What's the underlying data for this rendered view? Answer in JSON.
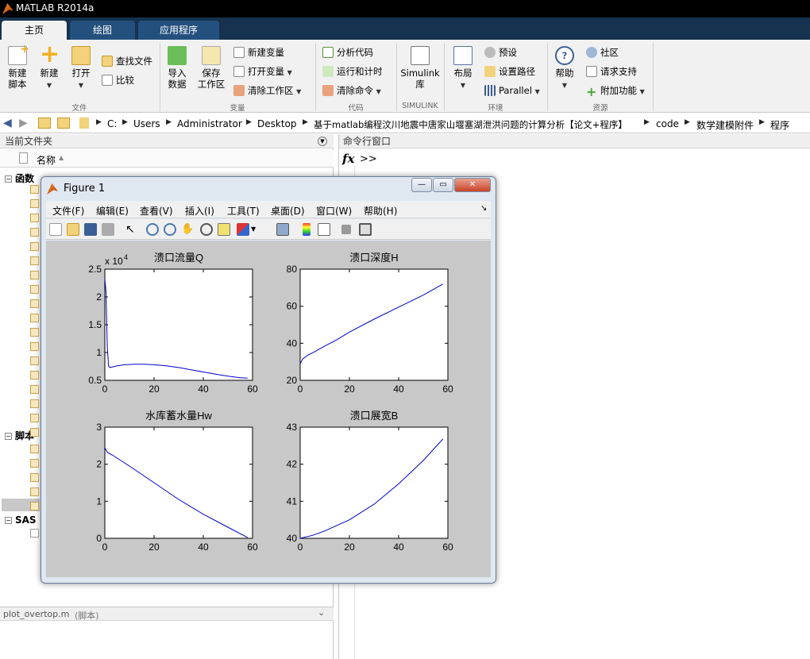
{
  "app": {
    "title": "MATLAB R2014a"
  },
  "tabs": [
    {
      "label": "主页"
    },
    {
      "label": "绘图"
    },
    {
      "label": "应用程序"
    }
  ],
  "ribbon": {
    "file": {
      "new_script": [
        "新建",
        "脚本"
      ],
      "new": "新建",
      "open": "打开",
      "find_files": "查找文件",
      "compare": "比较",
      "group": "文件"
    },
    "variable": {
      "import": [
        "导入",
        "数据"
      ],
      "save_ws": [
        "保存",
        "工作区"
      ],
      "new_var": "新建变量",
      "open_var": "打开变量",
      "clear_ws": "清除工作区",
      "group": "变量"
    },
    "code": {
      "analyze": "分析代码",
      "run_time": "运行和计时",
      "clear_cmd": "清除命令",
      "group": "代码"
    },
    "simulink": {
      "lib": [
        "Simulink",
        "库"
      ],
      "group": "SIMULINK"
    },
    "env": {
      "layout": "布局",
      "prefs": "预设",
      "set_path": "设置路径",
      "parallel": "Parallel",
      "group": "环境"
    },
    "res": {
      "help": "帮助",
      "community": "社区",
      "support": "请求支持",
      "addons": "附加功能",
      "group": "资源"
    }
  },
  "address": [
    "C:",
    "Users",
    "Administrator",
    "Desktop",
    "基于matlab编程汶川地震中唐家山堰塞湖泄洪问题的计算分析【论文+程序】",
    "code",
    "数学建模附件",
    "程序"
  ],
  "current_folder": {
    "title": "当前文件夹",
    "col_name": "名称",
    "group_functions": "函数",
    "group_scripts": "脚本",
    "group_sas": "SAS",
    "details_file": "plot_overtop.m",
    "details_type": "(脚本)"
  },
  "command": {
    "title": "命令行窗口",
    "fx": "fx",
    "prompt": ">>"
  },
  "figure": {
    "title": "Figure 1",
    "menu": [
      "文件(F)",
      "编辑(E)",
      "查看(V)",
      "插入(I)",
      "工具(T)",
      "桌面(D)",
      "窗口(W)",
      "帮助(H)"
    ]
  },
  "colors": {
    "line": "#0000cc",
    "plot_bg": "#c8c8c8",
    "tab_bg": "#16324f"
  },
  "chart_data": [
    {
      "type": "line",
      "title": "溃口流量Q",
      "exponent_label": "x 10",
      "exponent_power": "4",
      "x_ticks": [
        "0",
        "20",
        "40",
        "60"
      ],
      "y_ticks": [
        "0.5",
        "1",
        "1.5",
        "2",
        "2.5"
      ],
      "xlim": [
        0,
        60
      ],
      "ylim": [
        0.5,
        2.5
      ],
      "x": [
        0,
        0.5,
        1,
        1.5,
        2,
        3,
        5,
        8,
        12,
        16,
        20,
        25,
        30,
        35,
        40,
        45,
        50,
        55,
        58
      ],
      "y": [
        2.32,
        2.1,
        1.1,
        0.76,
        0.73,
        0.74,
        0.76,
        0.78,
        0.79,
        0.79,
        0.78,
        0.76,
        0.73,
        0.69,
        0.65,
        0.61,
        0.575,
        0.545,
        0.54
      ]
    },
    {
      "type": "line",
      "title": "溃口深度H",
      "x_ticks": [
        "0",
        "20",
        "40",
        "60"
      ],
      "y_ticks": [
        "20",
        "40",
        "60",
        "80"
      ],
      "xlim": [
        0,
        60
      ],
      "ylim": [
        20,
        80
      ],
      "x": [
        0,
        1,
        3,
        6,
        10,
        15,
        20,
        30,
        40,
        50,
        58
      ],
      "y": [
        29,
        31.5,
        33.5,
        35.5,
        38.5,
        42,
        46,
        53,
        59.5,
        66,
        72
      ]
    },
    {
      "type": "line",
      "title": "水库蓄水量Hw",
      "x_ticks": [
        "0",
        "20",
        "40",
        "60"
      ],
      "y_ticks": [
        "0",
        "1",
        "2",
        "3"
      ],
      "xlim": [
        0,
        60
      ],
      "ylim": [
        0,
        3
      ],
      "x": [
        0,
        1,
        3,
        10,
        20,
        30,
        40,
        50,
        58
      ],
      "y": [
        2.45,
        2.32,
        2.25,
        1.95,
        1.5,
        1.05,
        0.65,
        0.3,
        0.02
      ]
    },
    {
      "type": "line",
      "title": "溃口展宽B",
      "x_ticks": [
        "0",
        "20",
        "40",
        "60"
      ],
      "y_ticks": [
        "40",
        "41",
        "42",
        "43"
      ],
      "xlim": [
        0,
        60
      ],
      "ylim": [
        40,
        43
      ],
      "x": [
        0,
        5,
        10,
        20,
        30,
        40,
        50,
        58
      ],
      "y": [
        40.0,
        40.08,
        40.2,
        40.5,
        40.92,
        41.47,
        42.1,
        42.68
      ]
    }
  ]
}
